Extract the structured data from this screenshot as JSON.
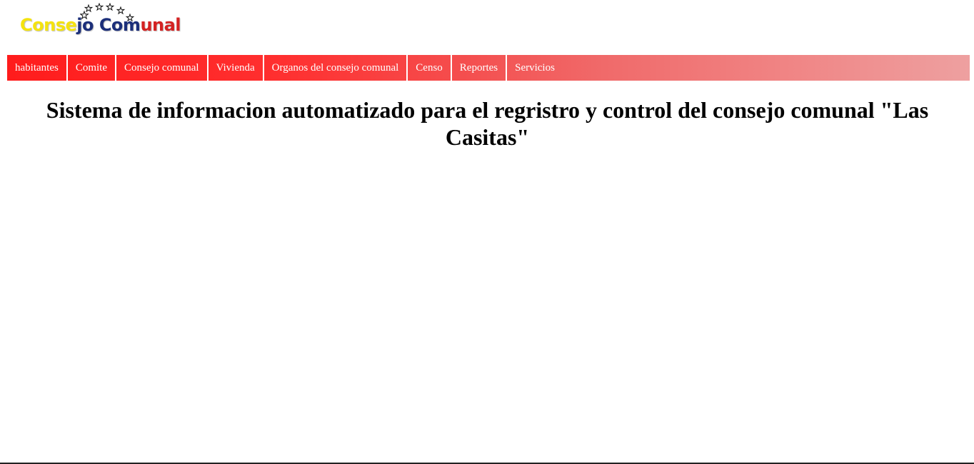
{
  "logo": {
    "part1": "Conse",
    "part2": "jo Co",
    "part3": "m",
    "part4": "unal",
    "colors": {
      "yellow": "#f4e30f",
      "blue": "#1c2f7a",
      "red": "#d42222"
    }
  },
  "menu": {
    "items": [
      {
        "label": "habitantes"
      },
      {
        "label": "Comite"
      },
      {
        "label": "Consejo comunal"
      },
      {
        "label": "Vivienda"
      },
      {
        "label": "Organos del consejo comunal"
      },
      {
        "label": "Censo"
      },
      {
        "label": "Reportes"
      },
      {
        "label": "Servicios"
      }
    ],
    "colors": {
      "start": "#ff1c1c",
      "end": "#eea0a0",
      "text": "#ffffff"
    }
  },
  "main": {
    "title": "Sistema de informacion automatizado para el regristro y control del consejo comunal \"Las Casitas\""
  }
}
